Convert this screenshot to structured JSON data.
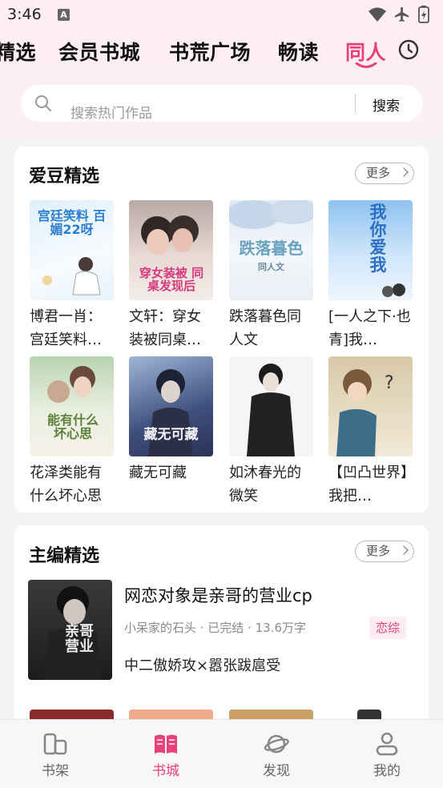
{
  "status_bar": {
    "time": "3:46",
    "notification_letter": "A"
  },
  "tabs": [
    {
      "label": "精选"
    },
    {
      "label": "会员书城"
    },
    {
      "label": "书荒广场"
    },
    {
      "label": "畅读"
    },
    {
      "label": "同人",
      "active": true
    }
  ],
  "search": {
    "placeholder": "搜索热门作品",
    "button": "搜索"
  },
  "idol_section": {
    "title": "爱豆精选",
    "more": "更多",
    "books": [
      {
        "title": "博君一肖：宫廷笑料…",
        "cover_text": "宫廷笑料 百媚22呀"
      },
      {
        "title": "文轩：穿女装被同桌…",
        "cover_text": "穿女装被 同桌发现后"
      },
      {
        "title": "跌落暮色同人文",
        "cover_text": "跌落暮色",
        "cover_sub": "同人文"
      },
      {
        "title": "[一人之下·也青]我…",
        "cover_text": "我 你 爱 我"
      },
      {
        "title": "花泽类能有什么坏心思",
        "cover_text": "能有什么 坏心思"
      },
      {
        "title": "藏无可藏",
        "cover_text": "藏无可藏"
      },
      {
        "title": "如沐春光的微笑",
        "cover_text": ""
      },
      {
        "title": "【凹凸世界】我把…",
        "cover_text": ""
      }
    ]
  },
  "editor_section": {
    "title": "主编精选",
    "more": "更多",
    "pick": {
      "title": "网恋对象是亲哥的营业cp",
      "meta": "小呆家的石头 · 已完结 · 13.6万字",
      "tag": "恋综",
      "desc": "中二傲娇攻×嚣张跋扈受",
      "cover_text": "亲哥营业"
    }
  },
  "bottom_nav": [
    {
      "label": "书架",
      "icon": "bookshelf-icon"
    },
    {
      "label": "书城",
      "icon": "open-book-icon",
      "active": true
    },
    {
      "label": "发现",
      "icon": "planet-icon"
    },
    {
      "label": "我的",
      "icon": "person-icon"
    }
  ],
  "colors": {
    "accent": "#e8407a",
    "top_bg": "#fdeef4",
    "page_bg": "#f4f4f4"
  }
}
